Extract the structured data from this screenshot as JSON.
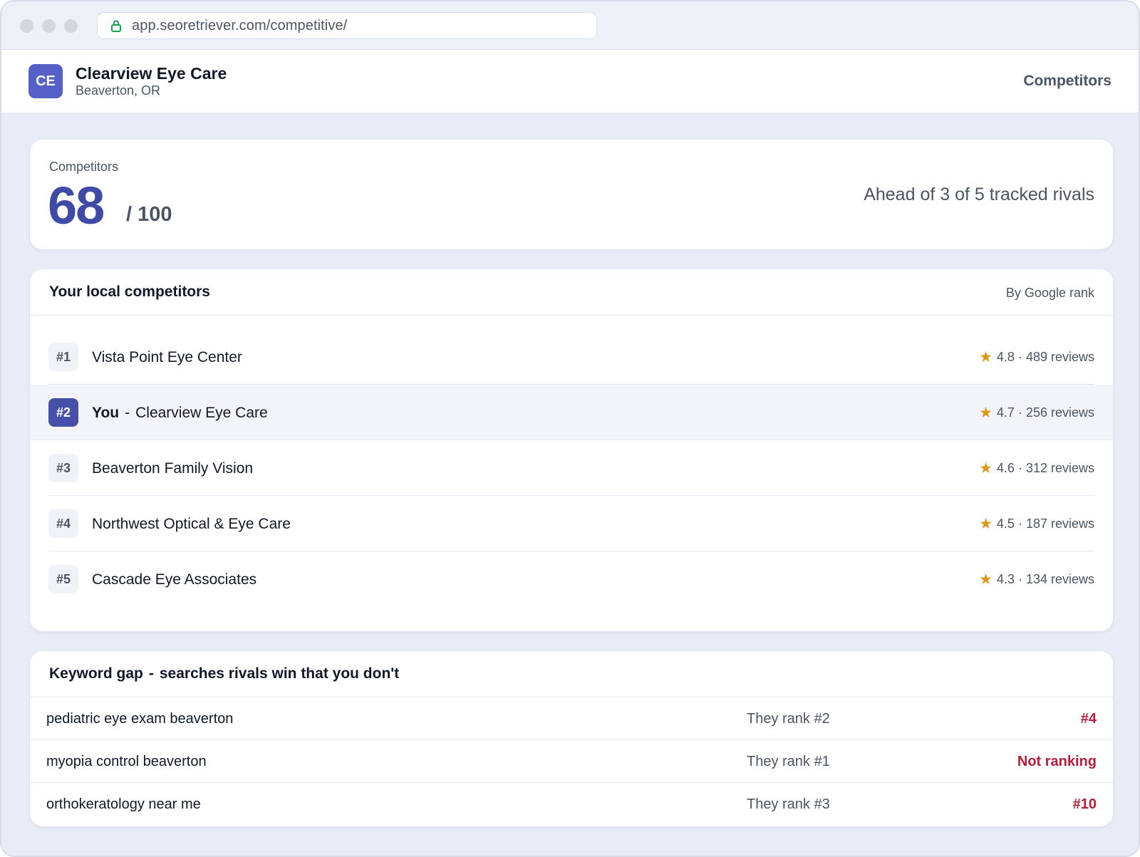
{
  "browser": {
    "url": "app.seoretriever.com/competitive/"
  },
  "header": {
    "avatar_initials": "CE",
    "business_name": "Clearview Eye Care",
    "location": "Beaverton, OR",
    "nav_label": "Competitors"
  },
  "score": {
    "label": "Competitors",
    "value": "68",
    "max": "/ 100",
    "summary": "Ahead of 3 of 5 tracked rivals"
  },
  "competitors": {
    "title": "Your local competitors",
    "sort_label": "By Google rank",
    "rows": [
      {
        "rank": "#1",
        "name": "Vista Point Eye Center",
        "stats": "4.8 · 489 reviews"
      },
      {
        "rank": "#2",
        "you_label": "You",
        "separator": "-",
        "name": "Clearview Eye Care",
        "stats": "4.7 · 256 reviews"
      },
      {
        "rank": "#3",
        "name": "Beaverton Family Vision",
        "stats": "4.6 · 312 reviews"
      },
      {
        "rank": "#4",
        "name": "Northwest Optical & Eye Care",
        "stats": "4.5 · 187 reviews"
      },
      {
        "rank": "#5",
        "name": "Cascade Eye Associates",
        "stats": "4.3 · 134 reviews"
      }
    ],
    "star_icon": "★",
    "star_color": "#d99a1b",
    "you_highlight_color": "#4650a8"
  },
  "keyword_gap": {
    "title_main": "Keyword gap",
    "title_sep": "-",
    "title_sub": "searches rivals win that you don't",
    "rows": [
      {
        "term": "pediatric eye exam beaverton",
        "they": "They rank #2",
        "you": "#4"
      },
      {
        "term": "myopia control beaverton",
        "they": "They rank #1",
        "you": "Not ranking"
      },
      {
        "term": "orthokeratology near me",
        "they": "They rank #3",
        "you": "#10"
      }
    ],
    "alert_color": "#b81d3a"
  },
  "colors": {
    "accent": "#3f4aa6",
    "brand": "#5561c9",
    "background": "#e9ecf6"
  }
}
